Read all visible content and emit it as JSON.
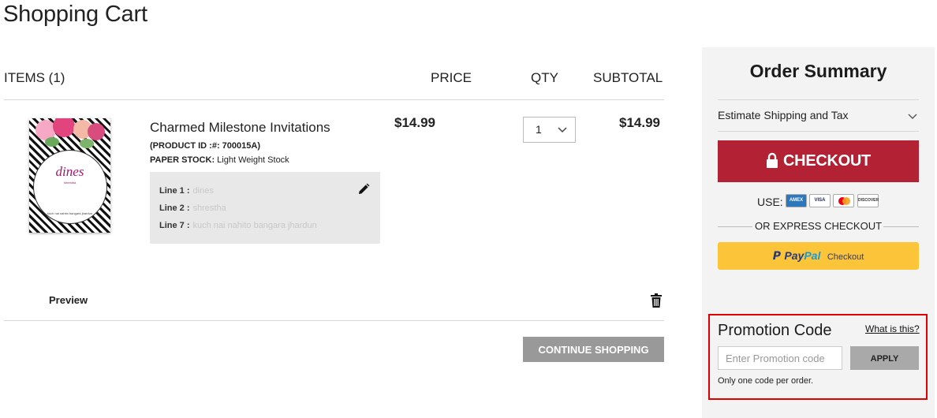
{
  "page": {
    "title": "Shopping Cart"
  },
  "cart": {
    "headers": {
      "items": "ITEMS (1)",
      "price": "PRICE",
      "qty": "QTY",
      "subtotal": "SUBTOTAL"
    },
    "item": {
      "name": "Charmed Milestone Invitations",
      "product_id_label": "(PRODUCT ID :#: 700015A)",
      "paper_stock_label": "PAPER STOCK:",
      "paper_stock_value": "Light Weight Stock",
      "thumbnail_text": {
        "name": "dines",
        "sub": "shrestha",
        "line": "kuch nai nahito bangara jhardun"
      },
      "lines": [
        {
          "label": "Line 1 :",
          "value": "dines"
        },
        {
          "label": "Line 2 :",
          "value": "shrestha"
        },
        {
          "label": "Line 7 :",
          "value": "kuch nai nahito bangara jhardun"
        }
      ],
      "price": "$14.99",
      "qty": "1",
      "subtotal": "$14.99",
      "preview_label": "Preview"
    },
    "continue_label": "CONTINUE SHOPPING"
  },
  "summary": {
    "title": "Order Summary",
    "shipping_label": "Estimate Shipping and Tax",
    "checkout_label": "CHECKOUT",
    "use_label": "USE:",
    "cards": [
      "AMEX",
      "VISA",
      "MC",
      "DISCOVER"
    ],
    "express_label": "OR EXPRESS CHECKOUT",
    "paypal": {
      "pay": "Pay",
      "pal": "Pal",
      "checkout": "Checkout"
    }
  },
  "promo": {
    "title": "Promotion Code",
    "what_link": "What is this?",
    "placeholder": "Enter Promotion code",
    "apply_label": "APPLY",
    "note": "Only one code per order."
  },
  "colors": {
    "checkout": "#b22234",
    "paypal": "#fcc439",
    "promo_border": "#e00000",
    "continue": "#999999"
  }
}
